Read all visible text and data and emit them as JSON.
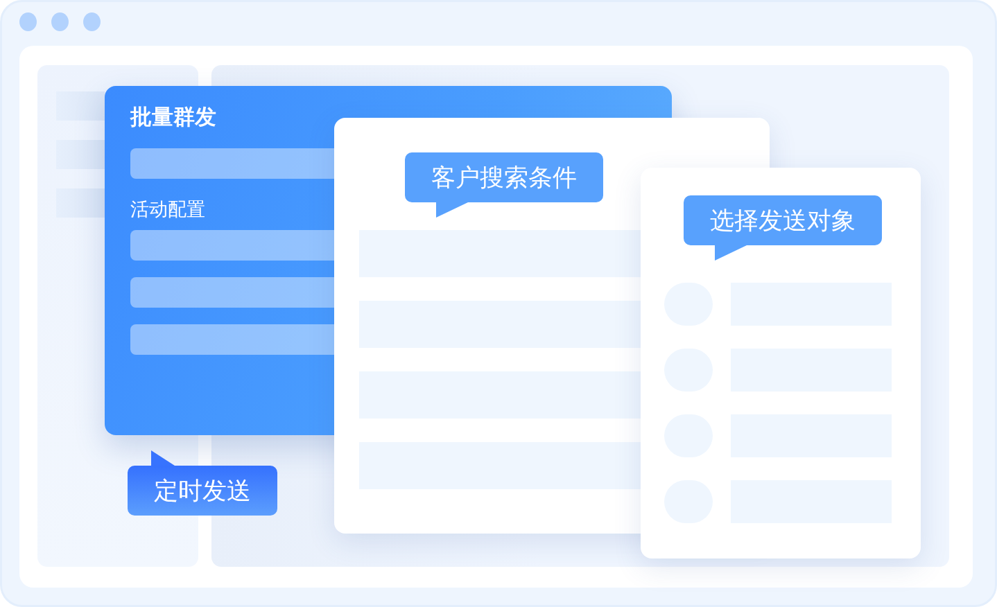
{
  "bulk_send_panel": {
    "title": "批量群发",
    "section_label": "活动配置"
  },
  "search_panel": {
    "callout": "客户搜索条件"
  },
  "recipients_panel": {
    "callout": "选择发送对象"
  },
  "schedule_callout": {
    "text": "定时发送"
  }
}
